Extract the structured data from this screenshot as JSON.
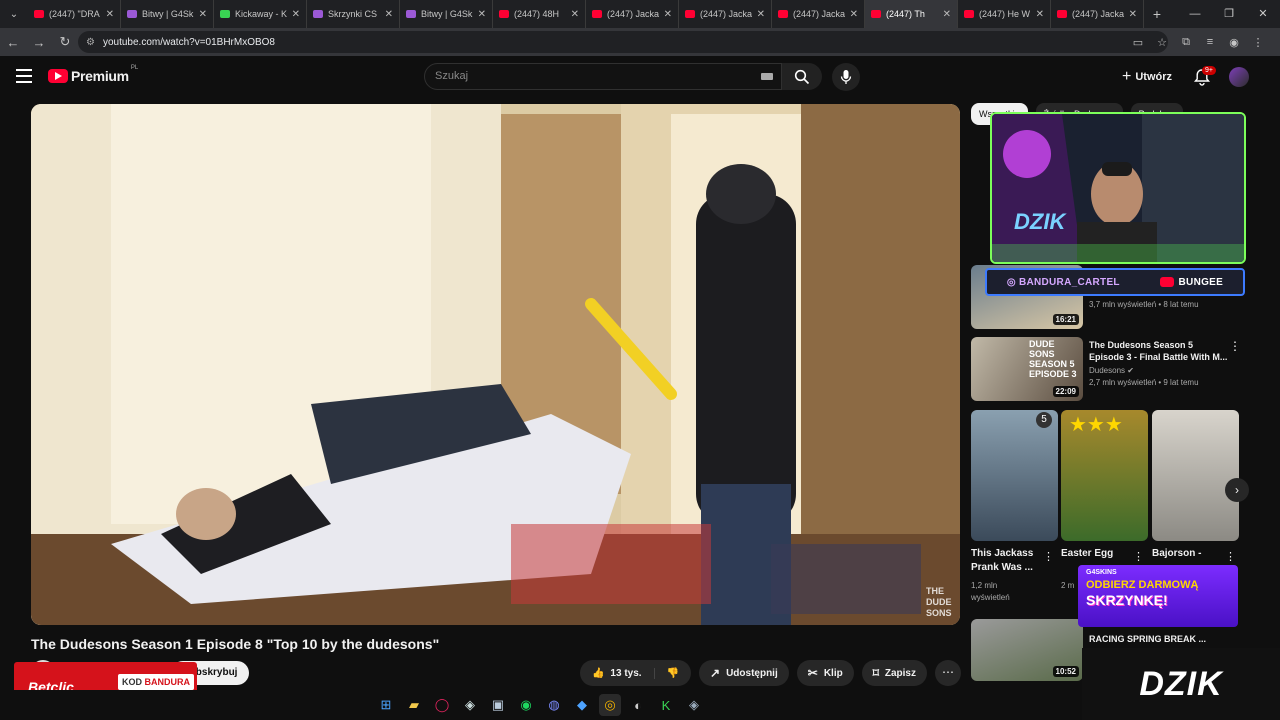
{
  "browser": {
    "tabs": [
      {
        "label": "(2447) \"DRA",
        "fav": "youtube",
        "active": false
      },
      {
        "label": "Bitwy | G4Sk",
        "fav": "purple",
        "active": false
      },
      {
        "label": "Kickaway - K",
        "fav": "green",
        "active": false
      },
      {
        "label": "Skrzynki CS",
        "fav": "purple",
        "active": false
      },
      {
        "label": "Bitwy | G4Sk",
        "fav": "purple",
        "active": false
      },
      {
        "label": "(2447) 48H",
        "fav": "youtube",
        "active": false
      },
      {
        "label": "(2447) Jacka",
        "fav": "youtube",
        "active": false
      },
      {
        "label": "(2447) Jacka",
        "fav": "youtube",
        "active": false
      },
      {
        "label": "(2447) Jacka",
        "fav": "youtube",
        "active": false
      },
      {
        "label": "(2447) Th",
        "fav": "youtube",
        "active": true
      },
      {
        "label": "(2447) He W",
        "fav": "youtube",
        "active": false
      },
      {
        "label": "(2447) Jacka",
        "fav": "youtube",
        "active": false
      }
    ],
    "url": "youtube.com/watch?v=01BHrMxOBO8"
  },
  "header": {
    "brand": "Premium",
    "region": "PL",
    "search_placeholder": "Szukaj",
    "create_label": "Utwórz",
    "notif_count": "9+"
  },
  "video": {
    "title": "The Dudesons Season 1 Episode 8 \"Top 10 by the dudesons\"",
    "subscribe_label": "Subskrybuj",
    "likes": "13 tys.",
    "share": "Udostępnij",
    "clip": "Klip",
    "save": "Zapisz"
  },
  "sidebar": {
    "chips": [
      "Wszystkie",
      "Źródło: Dudesons",
      "Podobne"
    ],
    "recs": [
      {
        "title": "",
        "views": "3,7 mln wyświetleń • 8 lat temu",
        "duration": "16:21"
      },
      {
        "title": "The Dudesons Season 5 Episode 3 - Final Battle With M...",
        "channel": "Dudesons",
        "views": "2,7 mln wyświetleń • 9 lat temu",
        "duration": "22:09"
      },
      {
        "title": "RACING SPRING BREAK ...",
        "duration": "10:52"
      }
    ],
    "shorts": [
      {
        "title": "This Jackass Prank Was ...",
        "views": "1,2 mln wyświetleń"
      },
      {
        "title": "Easter Egg",
        "views": "2 m"
      },
      {
        "title": "Bajorson -",
        "views": ""
      }
    ],
    "shorts_badge": "5"
  },
  "overlays": {
    "social_ig": "BANDURA_CARTEL",
    "social_yt": "BUNGEE",
    "g4_brand": "G4SKINS",
    "g4_line1": "ODBIERZ DARMOWĄ",
    "g4_line2": "SKRZYNKĘ!",
    "dzik": "DZIK",
    "betclic": "Betclic",
    "betclic_kod_label": "KOD",
    "betclic_kod": "BANDURA"
  }
}
